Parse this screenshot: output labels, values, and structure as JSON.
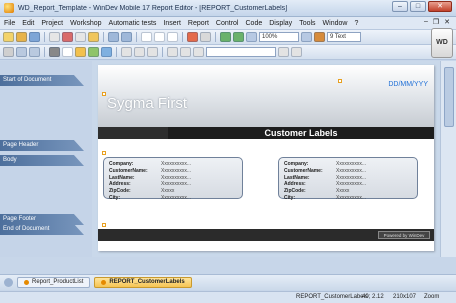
{
  "window": {
    "title": "WD_Report_Template - WinDev Mobile 17 Report Editor - [REPORT_CustomerLabels]",
    "minimize": "–",
    "maximize": "□",
    "close": "✕"
  },
  "menu": {
    "items": [
      "File",
      "Edit",
      "Project",
      "Workshop",
      "Automatic tests",
      "Insert",
      "Report",
      "Control",
      "Code",
      "Display",
      "Tools",
      "Window",
      "?"
    ],
    "right": [
      "–",
      "❐",
      "✕"
    ]
  },
  "toolbar": {
    "zoom": "100%",
    "font_size": "9 Text",
    "logo": "WD"
  },
  "bands": {
    "start_of_document": "Start of Document",
    "page_header": "Page Header",
    "body": "Body",
    "page_footer": "Page Footer",
    "end_of_document": "End of Document"
  },
  "report": {
    "brand": "Sygma First",
    "date_placeholder": "DD/MM/YYY",
    "title": "Customer Labels",
    "powered_by": "Powered by WinDev"
  },
  "labels": [
    {
      "rows": [
        {
          "label": "Company:",
          "value": "Xxxxxxxxxx..."
        },
        {
          "label": "CustomerName:",
          "value": "Xxxxxxxxxx..."
        },
        {
          "label": "LastName:",
          "value": "Xxxxxxxxxx..."
        },
        {
          "label": "Address:",
          "value": "Xxxxxxxxxx..."
        },
        {
          "label": "ZipCode:",
          "value": "Xxxxx"
        },
        {
          "label": "City:",
          "value": "Xxxxxxxxxx..."
        }
      ]
    },
    {
      "rows": [
        {
          "label": "Company:",
          "value": "Xxxxxxxxxx..."
        },
        {
          "label": "CustomerName:",
          "value": "Xxxxxxxxxx..."
        },
        {
          "label": "LastName:",
          "value": "Xxxxxxxxxx..."
        },
        {
          "label": "Address:",
          "value": "Xxxxxxxxxx..."
        },
        {
          "label": "ZipCode:",
          "value": "Xxxxx"
        },
        {
          "label": "City:",
          "value": "Xxxxxxxxxx..."
        }
      ]
    }
  ],
  "tabs": [
    {
      "label": "Report_ProductList",
      "active": false
    },
    {
      "label": "REPORT_CustomerLabels",
      "active": true
    }
  ],
  "status": {
    "report": "REPORT_CustomerLabels",
    "position": "40; 2.12",
    "size": "210x107",
    "zoom": "Zoom 100%"
  },
  "colors": {
    "accent": "#1f6fd6",
    "band": "#4d6f9c",
    "active_tab": "#f6c453"
  }
}
